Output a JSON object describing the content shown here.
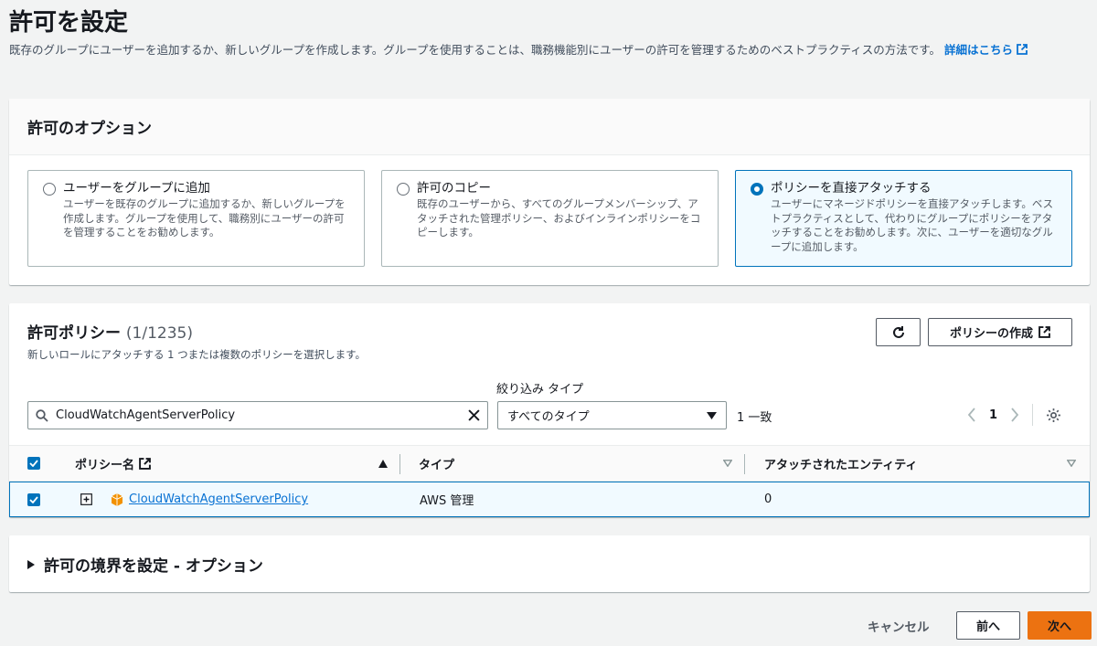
{
  "page": {
    "title": "許可を設定",
    "description": "既存のグループにユーザーを追加するか、新しいグループを作成します。グループを使用することは、職務機能別にユーザーの許可を管理するためのベストプラクティスの方法です。",
    "learn_more": "詳細はこちら"
  },
  "options": {
    "header": "許可のオプション",
    "items": [
      {
        "title": "ユーザーをグループに追加",
        "desc": "ユーザーを既存のグループに追加するか、新しいグループを作成します。グループを使用して、職務別にユーザーの許可を管理することをお勧めします。",
        "selected": false
      },
      {
        "title": "許可のコピー",
        "desc": "既存のユーザーから、すべてのグループメンバーシップ、アタッチされた管理ポリシー、およびインラインポリシーをコピーします。",
        "selected": false
      },
      {
        "title": "ポリシーを直接アタッチする",
        "desc": "ユーザーにマネージドポリシーを直接アタッチします。ベストプラクティスとして、代わりにグループにポリシーをアタッチすることをお勧めします。次に、ユーザーを適切なグループに追加します。",
        "selected": true
      }
    ]
  },
  "policies": {
    "title": "許可ポリシー",
    "count": "(1/1235)",
    "subtitle": "新しいロールにアタッチする 1 つまたは複数のポリシーを選択します。",
    "create_label": "ポリシーの作成",
    "filter_type_label": "絞り込み タイプ",
    "search_value": "CloudWatchAgentServerPolicy",
    "type_select": "すべてのタイプ",
    "match_count": "1 一致",
    "page_number": "1",
    "columns": {
      "name": "ポリシー名",
      "type": "タイプ",
      "entities": "アタッチされたエンティティ"
    },
    "rows": [
      {
        "name": "CloudWatchAgentServerPolicy",
        "type": "AWS 管理",
        "entities": "0",
        "checked": true
      }
    ]
  },
  "boundary": {
    "header": "許可の境界を設定 - オプション"
  },
  "footer": {
    "cancel": "キャンセル",
    "back": "前へ",
    "next": "次へ"
  },
  "colors": {
    "accent": "#0073bb",
    "primary_button": "#ec7211",
    "link": "#0972d3"
  }
}
